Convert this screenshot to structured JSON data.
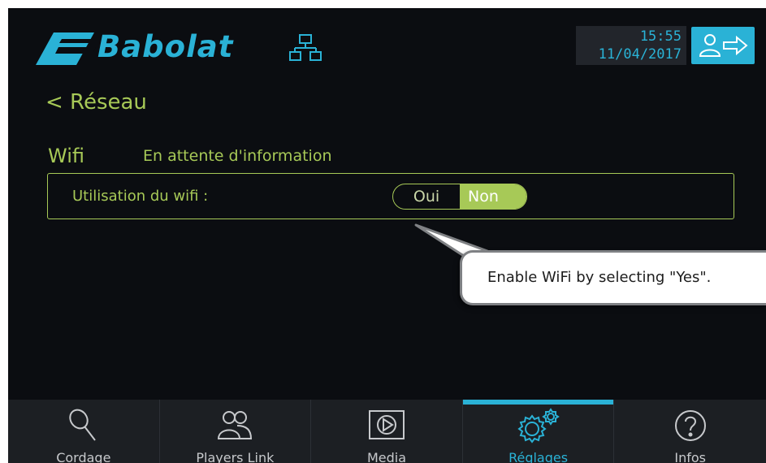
{
  "header": {
    "brand": "Babolat",
    "time": "15:55",
    "date": "11/04/2017",
    "network_icon": "network-icon",
    "logout_icon": "user-logout-icon"
  },
  "page": {
    "back_label": "< Réseau",
    "section_title": "Wifi",
    "status": "En attente d'information",
    "wifi_label": "Utilisation du wifi :",
    "toggle": {
      "yes": "Oui",
      "no": "Non",
      "selected": "Non"
    }
  },
  "tooltip": {
    "text": "Enable WiFi by selecting \"Yes\"."
  },
  "nav": [
    {
      "label": "Cordage",
      "icon": "racket-icon"
    },
    {
      "label": "Players Link",
      "icon": "players-icon"
    },
    {
      "label": "Media",
      "icon": "play-icon"
    },
    {
      "label": "Réglages",
      "icon": "settings-gears-icon",
      "active": true
    },
    {
      "label": "Infos",
      "icon": "help-icon"
    }
  ],
  "colors": {
    "accent": "#2ab2d6",
    "green": "#a7c957",
    "background": "#0b0d11"
  }
}
